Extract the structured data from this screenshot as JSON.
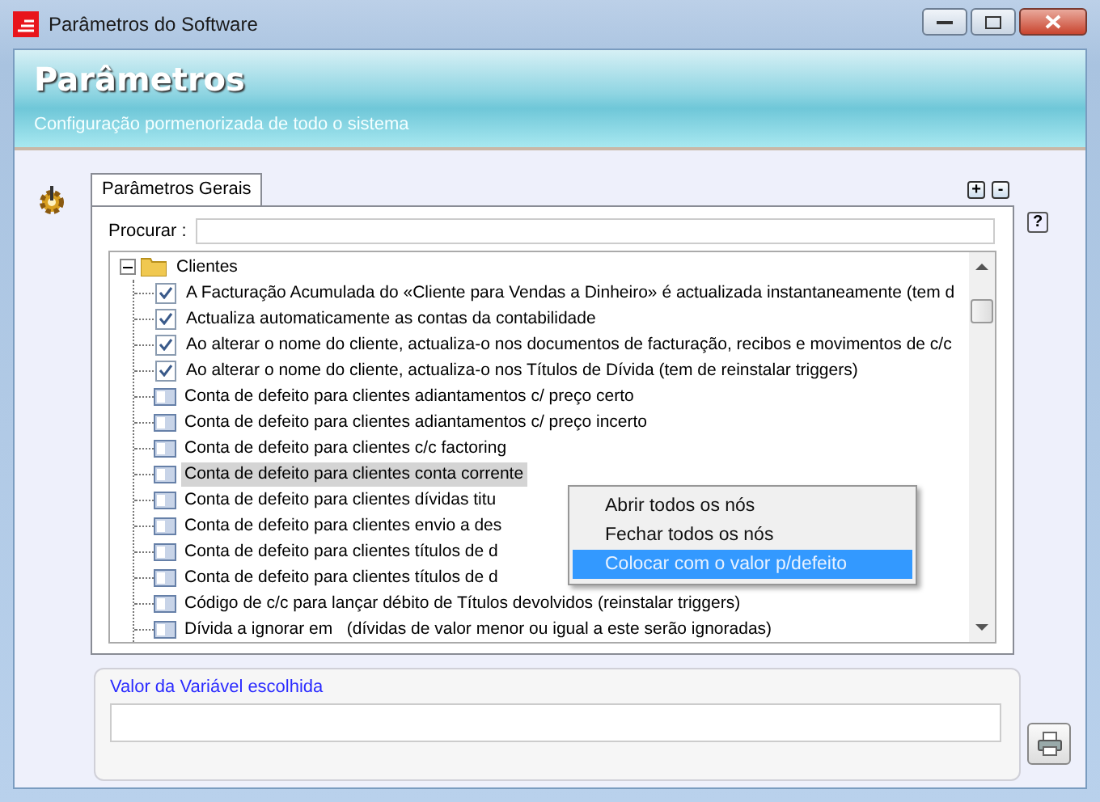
{
  "window": {
    "title": "Parâmetros do Software"
  },
  "header": {
    "title": "Parâmetros",
    "subtitle": "Configuração pormenorizada de todo o sistema"
  },
  "tabs": [
    {
      "label": "Parâmetros Gerais",
      "selected": true
    }
  ],
  "expand_buttons": [
    "+",
    "-"
  ],
  "help_button": "?",
  "search": {
    "label": "Procurar :"
  },
  "tree": [
    {
      "label": "Clientes",
      "expanded": true,
      "children": [
        {
          "kind": "checkbox",
          "label": "A Facturação Acumulada do «Cliente para Vendas a Dinheiro» é actualizada instantaneamente (tem d",
          "checked": true,
          "selected": false
        },
        {
          "kind": "checkbox",
          "label": "Actualiza automaticamente as contas da contabilidade",
          "checked": true,
          "selected": false
        },
        {
          "kind": "checkbox",
          "label": "Ao alterar o nome do cliente, actualiza-o nos documentos de facturação, recibos e movimentos de c/c",
          "checked": true,
          "selected": false
        },
        {
          "kind": "checkbox",
          "label": "Ao alterar o nome do cliente, actualiza-o nos Títulos de Dívida (tem de reinstalar triggers)",
          "checked": true,
          "selected": false
        },
        {
          "kind": "text",
          "label": "Conta de defeito para clientes adiantamentos c/ preço certo",
          "selected": false
        },
        {
          "kind": "text",
          "label": "Conta de defeito para clientes adiantamentos c/ preço incerto",
          "selected": false
        },
        {
          "kind": "text",
          "label": "Conta de defeito para clientes c/c factoring",
          "selected": false
        },
        {
          "kind": "text",
          "label": "Conta de defeito para clientes conta corrente",
          "selected": true
        },
        {
          "kind": "text",
          "label": "Conta de defeito para clientes dívidas titu",
          "selected": false
        },
        {
          "kind": "text",
          "label": "Conta de defeito para clientes envio a des",
          "selected": false
        },
        {
          "kind": "text",
          "label": "Conta de defeito para clientes títulos de d",
          "selected": false
        },
        {
          "kind": "text",
          "label": "Conta de defeito para clientes títulos de d",
          "selected": false
        },
        {
          "kind": "text",
          "label": "Código de c/c para lançar débito de Títulos devolvidos (reinstalar triggers)",
          "selected": false
        },
        {
          "kind": "text",
          "label": "Dívida a ignorar em   (dívidas de valor menor ou igual a este serão ignoradas)",
          "selected": false
        }
      ]
    }
  ],
  "context_menu": [
    {
      "label": "Abrir todos os nós",
      "selected": false
    },
    {
      "label": "Fechar todos os nós",
      "selected": false
    },
    {
      "label": "Colocar com o valor p/defeito",
      "selected": true
    }
  ],
  "value_group": {
    "label": "Valor da Variável escolhida"
  }
}
